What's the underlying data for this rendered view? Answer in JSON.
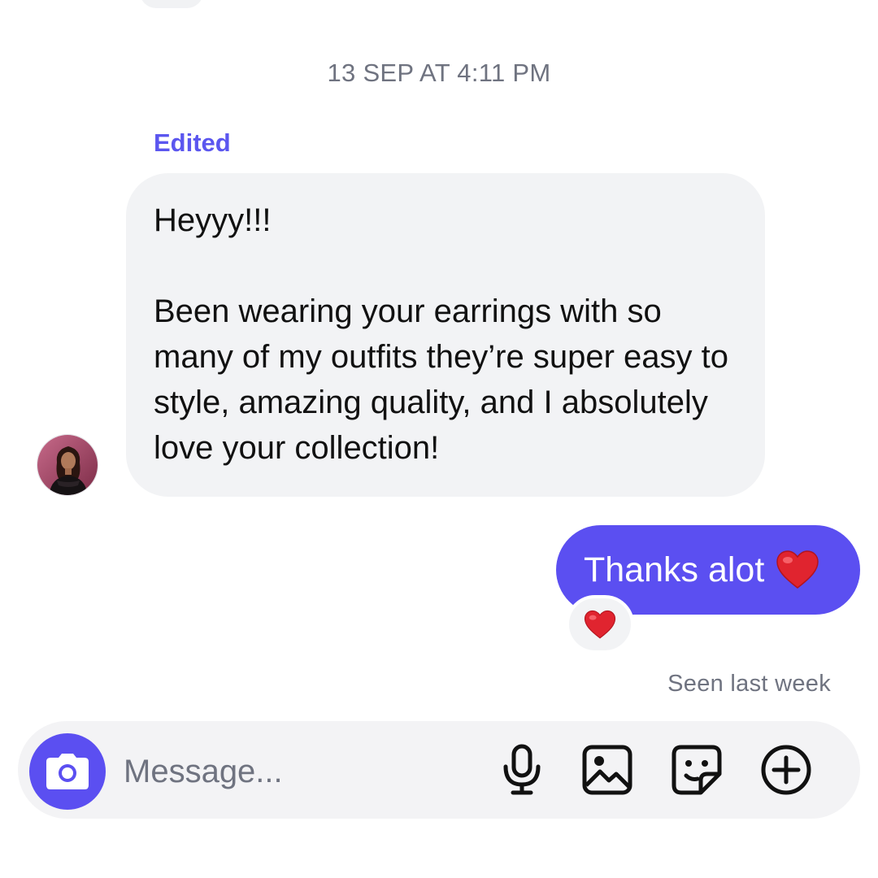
{
  "thread": {
    "timestamp": "13 SEP AT 4:11 PM",
    "received_message": {
      "edited_label": "Edited",
      "text": "Heyyy!!!\n\nBeen wearing your earrings with so many of my outfits they’re super easy to style, amazing quality, and I absolutely love your collection!",
      "avatar_icon": "user-avatar-photo"
    },
    "sent_message": {
      "text": "Thanks alot",
      "emoji_icon": "red-heart-emoji",
      "reaction_icon": "red-heart-emoji"
    },
    "seen_status": "Seen last week"
  },
  "composer": {
    "placeholder": "Message...",
    "value": "",
    "icons": [
      "camera-icon",
      "microphone-icon",
      "gallery-icon",
      "sticker-icon",
      "plus-icon"
    ]
  },
  "colors": {
    "accent": "#5b4ff1",
    "received_bubble": "#f2f3f5",
    "secondary_text": "#6f7380",
    "edited_label": "#5b56ef"
  }
}
